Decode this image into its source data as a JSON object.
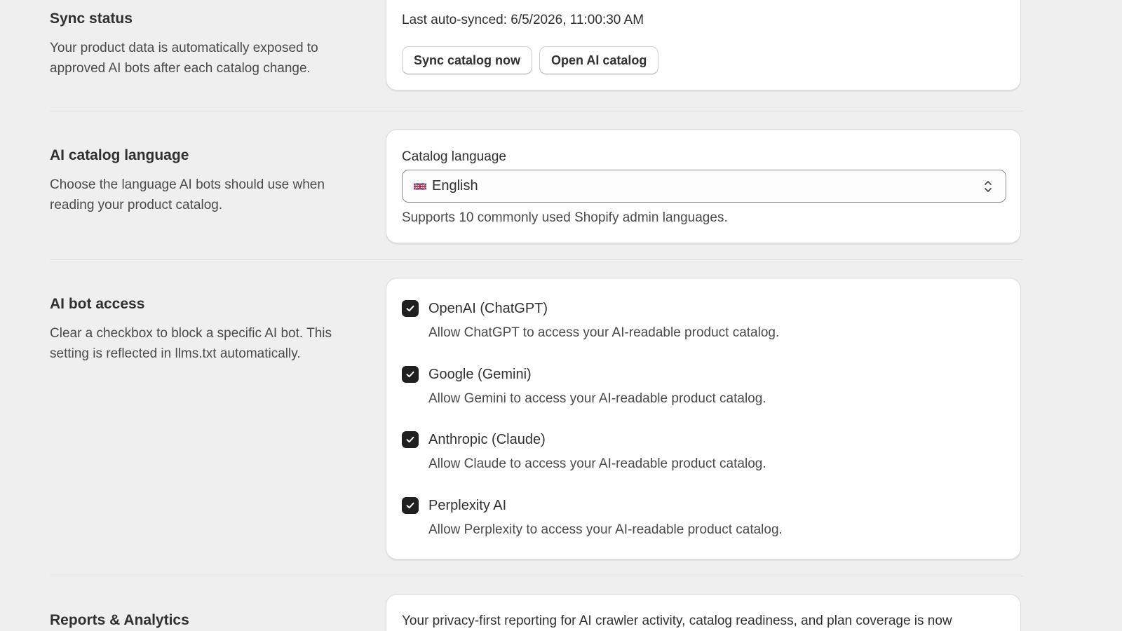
{
  "sync_status": {
    "title": "Sync status",
    "description": "Your product data is automatically exposed to approved AI bots after each catalog change.",
    "last_synced": "Last auto-synced: 6/5/2026, 11:00:30 AM",
    "sync_button": "Sync catalog now",
    "open_button": "Open AI catalog"
  },
  "catalog_language": {
    "title": "AI catalog language",
    "description": "Choose the language AI bots should use when reading your product catalog.",
    "field_label": "Catalog language",
    "selected_value": "English",
    "flag_icon": "uk-flag-icon",
    "help_text": "Supports 10 commonly used Shopify admin languages."
  },
  "bot_access": {
    "title": "AI bot access",
    "description": "Clear a checkbox to block a specific AI bot. This setting is reflected in llms.txt automatically.",
    "bots": [
      {
        "label": "OpenAI (ChatGPT)",
        "help": "Allow ChatGPT to access your AI-readable product catalog.",
        "checked": true
      },
      {
        "label": "Google (Gemini)",
        "help": "Allow Gemini to access your AI-readable product catalog.",
        "checked": true
      },
      {
        "label": "Anthropic (Claude)",
        "help": "Allow Claude to access your AI-readable product catalog.",
        "checked": true
      },
      {
        "label": "Perplexity AI",
        "help": "Allow Perplexity to access your AI-readable product catalog.",
        "checked": true
      }
    ]
  },
  "reports": {
    "title": "Reports & Analytics",
    "text": "Your privacy-first reporting for AI crawler activity, catalog readiness, and plan coverage is now"
  },
  "colors": {
    "background": "#efefef",
    "card": "#ffffff",
    "checkbox": "#1f1f1f",
    "text": "#303030"
  }
}
